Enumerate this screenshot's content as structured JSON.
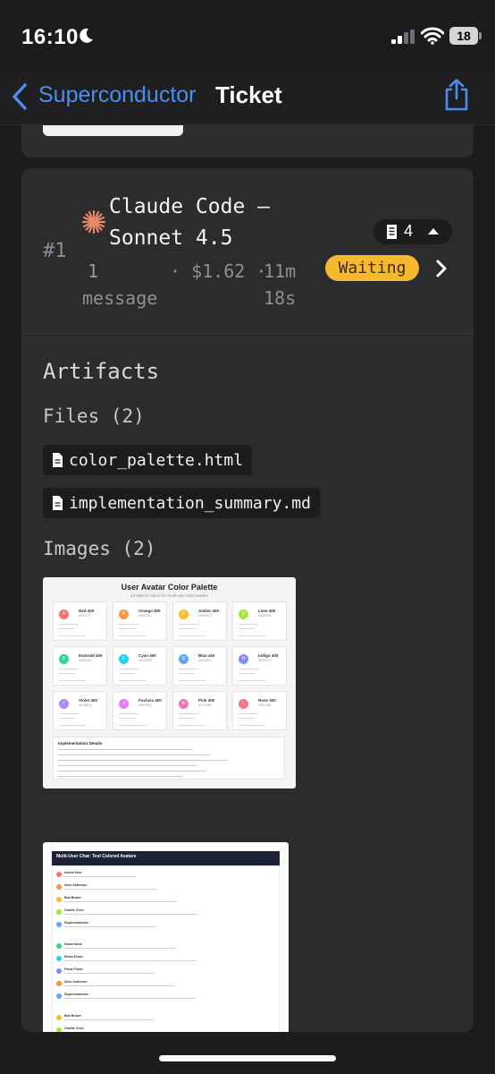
{
  "status_bar": {
    "time": "16:10",
    "battery": "18",
    "icons": [
      "moon-icon",
      "cellular-signal-icon",
      "wifi-icon",
      "battery-icon"
    ]
  },
  "nav": {
    "back_label": "Superconductor",
    "title": "Ticket",
    "share_icon": "share-icon"
  },
  "task": {
    "number": "#1",
    "title_line1": "Claude Code —",
    "title_line2": "Sonnet 4.5",
    "message_count": "1",
    "message_word": "message",
    "cost": "· $1.62 ·",
    "duration_line1": "11m",
    "duration_line2": "18s",
    "doc_count": "4",
    "status": "Waiting",
    "accent_color": "#e8896a",
    "status_color": "#f5b82e"
  },
  "artifacts": {
    "title": "Artifacts",
    "files_header": "Files (2)",
    "files": [
      "color_palette.html",
      "implementation_summary.md"
    ],
    "images_header": "Images (2)"
  },
  "thumbnail_1": {
    "title": "User Avatar Color Palette",
    "subtitle": "12 distinct colors for multi-user chat avatars",
    "swatches": [
      {
        "letter": "A",
        "name": "Red 400",
        "hex": "#F87171",
        "color": "#f87171"
      },
      {
        "letter": "B",
        "name": "Orange 400",
        "hex": "#FB923C",
        "color": "#fb923c"
      },
      {
        "letter": "C",
        "name": "Amber 400",
        "hex": "#FBBF24",
        "color": "#fbbf24"
      },
      {
        "letter": "D",
        "name": "Lime 400",
        "hex": "#A3E635",
        "color": "#a3e635"
      },
      {
        "letter": "E",
        "name": "Emerald 400",
        "hex": "#34D399",
        "color": "#34d399"
      },
      {
        "letter": "F",
        "name": "Cyan 400",
        "hex": "#22D3EE",
        "color": "#22d3ee"
      },
      {
        "letter": "G",
        "name": "Blue 400",
        "hex": "#60A5FA",
        "color": "#60a5fa"
      },
      {
        "letter": "H",
        "name": "Indigo 400",
        "hex": "#818CF8",
        "color": "#818cf8"
      },
      {
        "letter": "I",
        "name": "Violet 400",
        "hex": "#A78BFA",
        "color": "#a78bfa"
      },
      {
        "letter": "J",
        "name": "Fuchsia 400",
        "hex": "#E879F9",
        "color": "#e879f9"
      },
      {
        "letter": "K",
        "name": "Pink 400",
        "hex": "#F472B6",
        "color": "#f472b6"
      },
      {
        "letter": "L",
        "name": "Rose 400",
        "hex": "#FB7185",
        "color": "#fb7185"
      }
    ],
    "notes_title": "Implementation Details"
  },
  "thumbnail_2": {
    "title": "Multi-User Chat: Test Colored Avatars",
    "messages": [
      {
        "name": "Admin User",
        "color": "#f87171"
      },
      {
        "name": "Alice Anderson",
        "color": "#fb923c"
      },
      {
        "name": "Bob Brown",
        "color": "#fbbf24"
      },
      {
        "name": "Charlie Chen",
        "color": "#a3e635"
      },
      {
        "name": "Superconductor",
        "color": "#60a5fa"
      },
      {
        "name": "Diana Davis",
        "color": "#34d399"
      },
      {
        "name": "Ethan Evans",
        "color": "#22d3ee"
      },
      {
        "name": "Fiona Foster",
        "color": "#818cf8"
      },
      {
        "name": "Alice Anderson",
        "color": "#fb923c"
      },
      {
        "name": "Superconductor",
        "color": "#60a5fa"
      },
      {
        "name": "Bob Brown",
        "color": "#fbbf24"
      },
      {
        "name": "Charlie Chen",
        "color": "#a3e635"
      }
    ]
  }
}
